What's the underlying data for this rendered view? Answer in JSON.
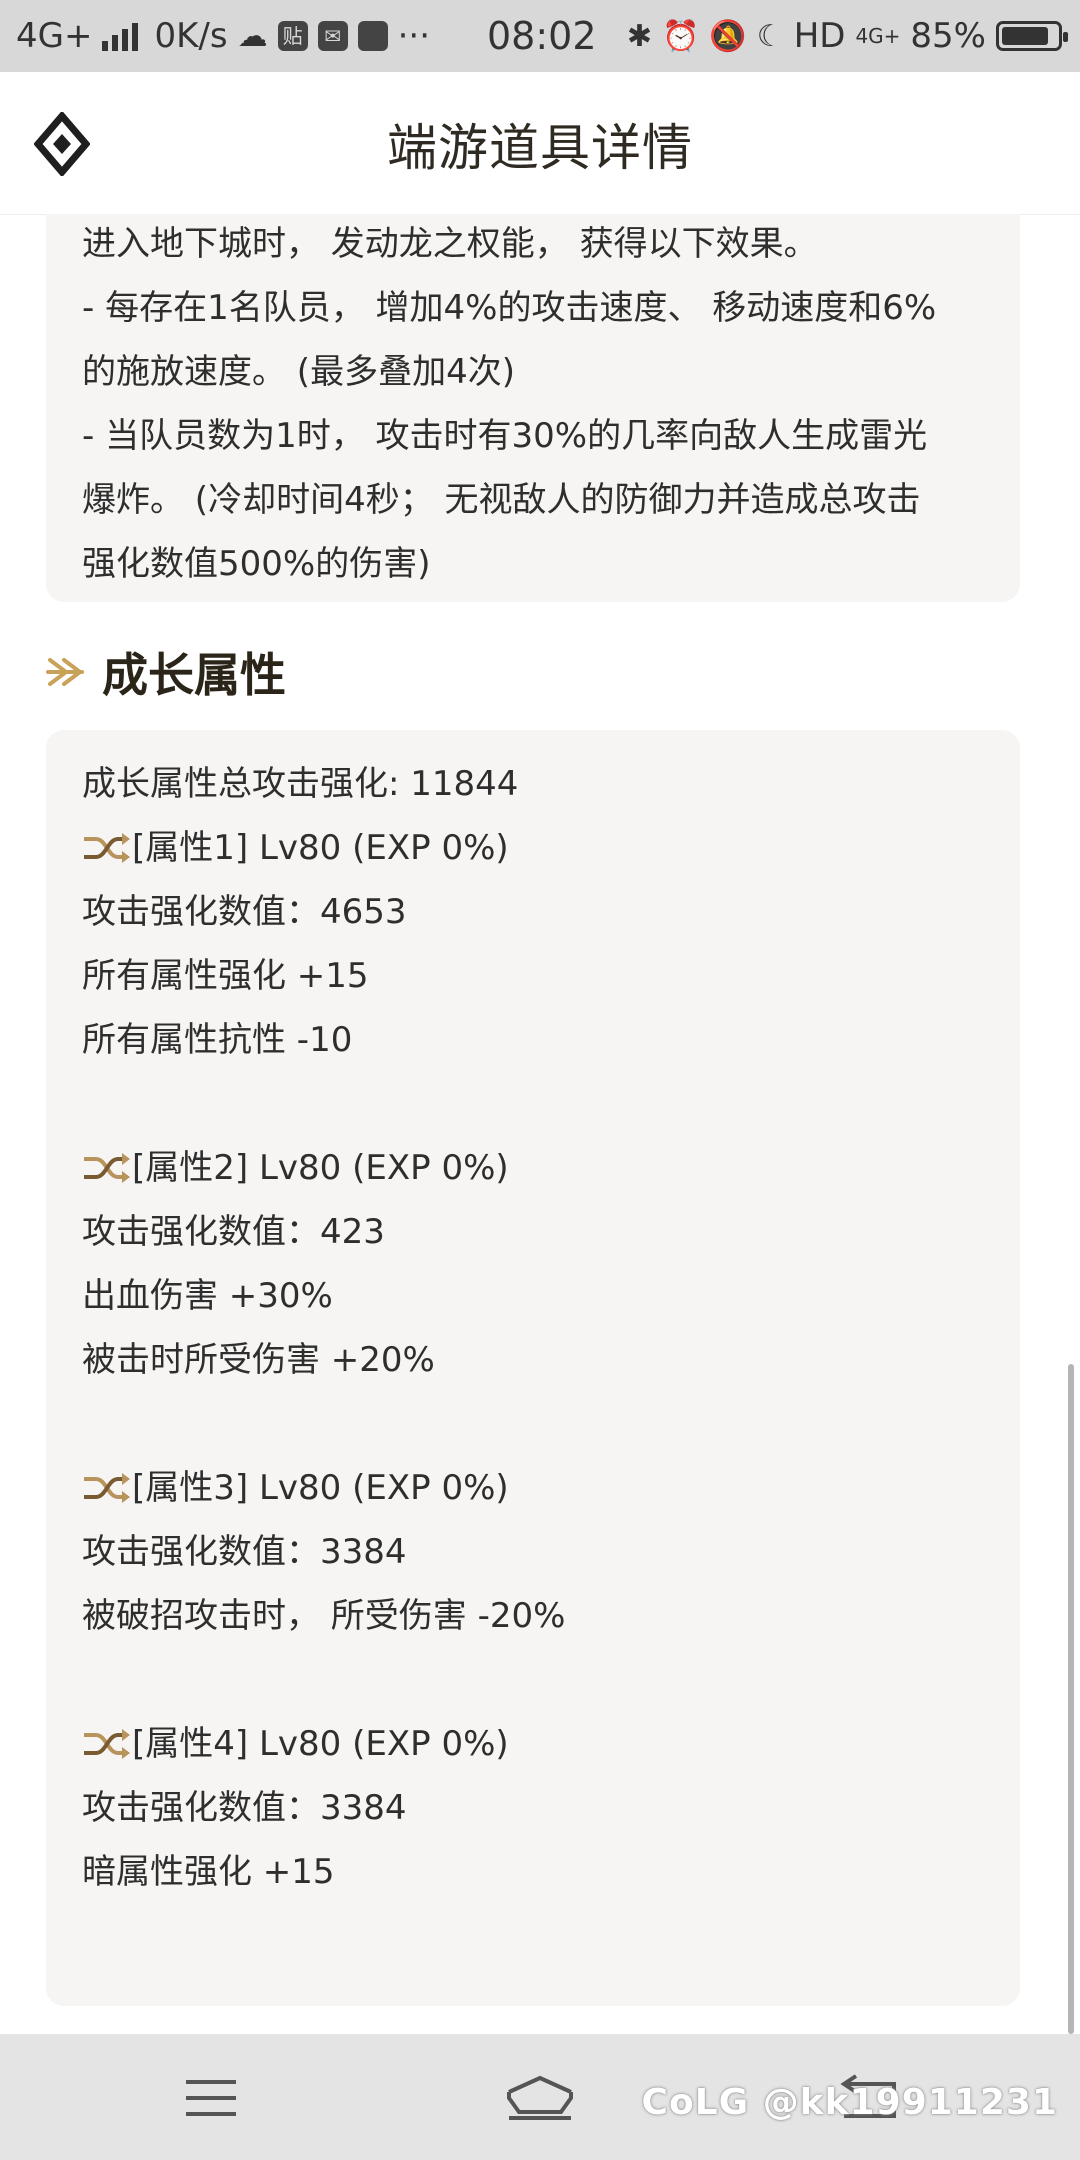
{
  "status_bar": {
    "network": "4G+",
    "speed": "0K/s",
    "time": "08:02",
    "hd": "HD",
    "network_right": "4G+",
    "battery_percent": "85%",
    "battery_level": 0.85
  },
  "header": {
    "title": "端游道具详情"
  },
  "effect_card": {
    "lines": [
      "进入地下城时， 发动龙之权能， 获得以下效果。",
      "- 每存在1名队员， 增加4%的攻击速度、 移动速度和6%",
      "的施放速度。 (最多叠加4次)",
      "- 当队员数为1时， 攻击时有30%的几率向敌人生成雷光",
      "爆炸。 (冷却时间4秒； 无视敌人的防御力并造成总攻击",
      "强化数值500%的伤害)"
    ]
  },
  "growth_section": {
    "title": "成长属性",
    "total": "成长属性总攻击强化: 11844",
    "attributes": [
      {
        "header": "[属性1] Lv80 (EXP 0%)",
        "lines": [
          "攻击强化数值：4653",
          "所有属性强化 +15",
          "所有属性抗性 -10"
        ]
      },
      {
        "header": "[属性2] Lv80 (EXP 0%)",
        "lines": [
          "攻击强化数值：423",
          "出血伤害 +30%",
          "被击时所受伤害 +20%"
        ]
      },
      {
        "header": "[属性3] Lv80 (EXP 0%)",
        "lines": [
          "攻击强化数值：3384",
          "被破招攻击时， 所受伤害 -20%"
        ]
      },
      {
        "header": "[属性4] Lv80 (EXP 0%)",
        "lines": [
          "攻击强化数值：3384",
          "暗属性强化 +15"
        ]
      }
    ]
  },
  "watermark": "CoLG @kk19911231",
  "colors": {
    "accent_gold": "#c9a25a",
    "card_bg": "#f6f5f3",
    "status_bar_bg": "#d8d8d8",
    "nav_bar_bg": "#e4e4e4"
  },
  "icons": {
    "logo": "diamond-logo-icon",
    "section": "double-arrow-icon",
    "attribute": "shuffle-icon",
    "nav_menu": "menu-icon",
    "nav_home": "home-icon",
    "nav_back": "back-icon"
  }
}
